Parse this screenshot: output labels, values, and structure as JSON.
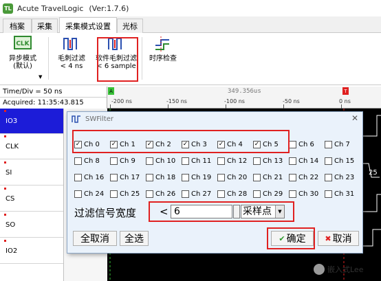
{
  "app": {
    "title": "Acute TravelLogic",
    "version": "(Ver:1.7.6)",
    "icon_text": "TL"
  },
  "tabs": [
    {
      "label": "档案"
    },
    {
      "label": "采集"
    },
    {
      "label": "采集模式设置"
    },
    {
      "label": "光标"
    }
  ],
  "ribbon": {
    "async_mode": {
      "line1": "异步模式",
      "line2": "(默认)",
      "icon": "clk-icon",
      "icon_text": "CLK"
    },
    "glitch_filter": {
      "line1": "毛刺过滤",
      "line2": "< 4 ns",
      "icon": "glitch-filter-icon"
    },
    "sw_glitch_filter": {
      "line1": "软件毛刺过滤",
      "line2": "< 6 sample",
      "icon": "sw-glitch-filter-icon"
    },
    "timing_check": {
      "label": "时序检查",
      "icon": "timing-check-icon"
    }
  },
  "left_panel": {
    "time_div": "Time/Div = 50 ns",
    "acquired": "Acquired: 11:35:43.815",
    "signals": [
      "IO3",
      "CLK",
      "SI",
      "CS",
      "SO",
      "IO2"
    ]
  },
  "ruler": {
    "measure": "349.356us",
    "labels": [
      "-200 ns",
      "-150 ns",
      "-100 ns",
      "-50 ns",
      "0 ns"
    ],
    "marker_a": "A",
    "marker_t": "T"
  },
  "wave_value": "25",
  "dialog": {
    "title": "SWFilter",
    "close": "✕",
    "channels": [
      {
        "label": "Ch 0",
        "checked": true
      },
      {
        "label": "Ch 1",
        "checked": true
      },
      {
        "label": "Ch 2",
        "checked": true
      },
      {
        "label": "Ch 3",
        "checked": true
      },
      {
        "label": "Ch 4",
        "checked": true
      },
      {
        "label": "Ch 5",
        "checked": true
      },
      {
        "label": "Ch 6",
        "checked": false
      },
      {
        "label": "Ch 7",
        "checked": false
      },
      {
        "label": "Ch 8",
        "checked": false
      },
      {
        "label": "Ch 9",
        "checked": false
      },
      {
        "label": "Ch 10",
        "checked": false
      },
      {
        "label": "Ch 11",
        "checked": false
      },
      {
        "label": "Ch 12",
        "checked": false
      },
      {
        "label": "Ch 13",
        "checked": false
      },
      {
        "label": "Ch 14",
        "checked": false
      },
      {
        "label": "Ch 15",
        "checked": false
      },
      {
        "label": "Ch 16",
        "checked": false
      },
      {
        "label": "Ch 17",
        "checked": false
      },
      {
        "label": "Ch 18",
        "checked": false
      },
      {
        "label": "Ch 19",
        "checked": false
      },
      {
        "label": "Ch 20",
        "checked": false
      },
      {
        "label": "Ch 21",
        "checked": false
      },
      {
        "label": "Ch 22",
        "checked": false
      },
      {
        "label": "Ch 23",
        "checked": false
      },
      {
        "label": "Ch 24",
        "checked": false
      },
      {
        "label": "Ch 25",
        "checked": false
      },
      {
        "label": "Ch 26",
        "checked": false
      },
      {
        "label": "Ch 27",
        "checked": false
      },
      {
        "label": "Ch 28",
        "checked": false
      },
      {
        "label": "Ch 29",
        "checked": false
      },
      {
        "label": "Ch 30",
        "checked": false
      },
      {
        "label": "Ch 31",
        "checked": false
      }
    ],
    "filter_label": "过滤信号宽度",
    "less_than": "<",
    "width_value": "6",
    "unit": "采样点",
    "deselect_all": "全取消",
    "select_all": "全选",
    "ok": "确定",
    "cancel": "取消"
  },
  "watermark": "嵌入式Lee",
  "colors": {
    "accent_red": "#e02020",
    "selected_signal": "#1c1cd8",
    "dialog_bg": "#eaf2fb"
  }
}
